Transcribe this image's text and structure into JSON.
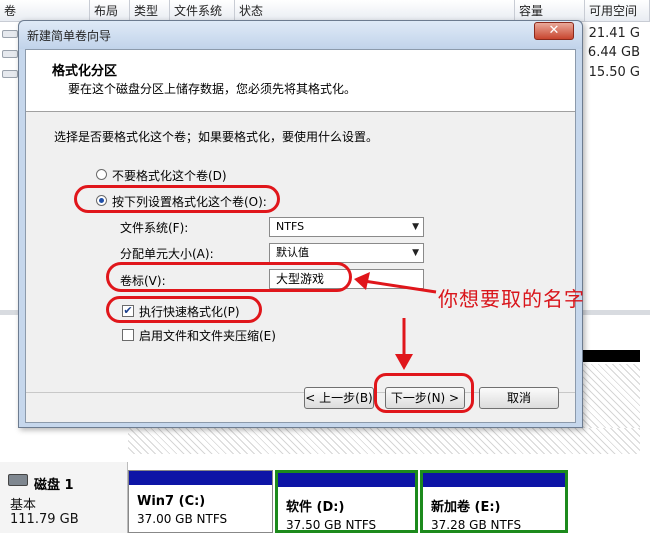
{
  "background": {
    "columns": [
      "卷",
      "布局",
      "类型",
      "文件系统",
      "状态",
      "容量",
      "可用空间"
    ],
    "sizes": [
      "21.41 G",
      "6.44 GB",
      "15.50 G"
    ],
    "disk": {
      "name": "磁盘 1",
      "type": "基本",
      "size": "111.79 GB"
    },
    "partitions": [
      {
        "name": "Win7  (C:)",
        "info": "37.00 GB NTFS"
      },
      {
        "name": "软件  (D:)",
        "info": "37.50 GB NTFS"
      },
      {
        "name": "新加卷  (E:)",
        "info": "37.28 GB NTFS"
      }
    ]
  },
  "wizard": {
    "title": "新建简单卷向导",
    "close_label": "✕",
    "header_title": "格式化分区",
    "header_subtitle": "要在这个磁盘分区上储存数据，您必须先将其格式化。",
    "prompt": "选择是否要格式化这个卷；如果要格式化，要使用什么设置。",
    "option_no_format": "不要格式化这个卷(D)",
    "option_format": "按下列设置格式化这个卷(O):",
    "filesystem_label": "文件系统(F):",
    "filesystem_value": "NTFS",
    "alloc_label": "分配单元大小(A):",
    "alloc_value": "默认值",
    "volume_label_label": "卷标(V):",
    "volume_label_value": "大型游戏",
    "quick_format_label": "执行快速格式化(P)",
    "compression_label": "启用文件和文件夹压缩(E)",
    "back_button": "< 上一步(B)",
    "next_button": "下一步(N) >",
    "cancel_button": "取消"
  },
  "annotation": {
    "text": "你想要取的名字",
    "color": "#e0161b"
  }
}
